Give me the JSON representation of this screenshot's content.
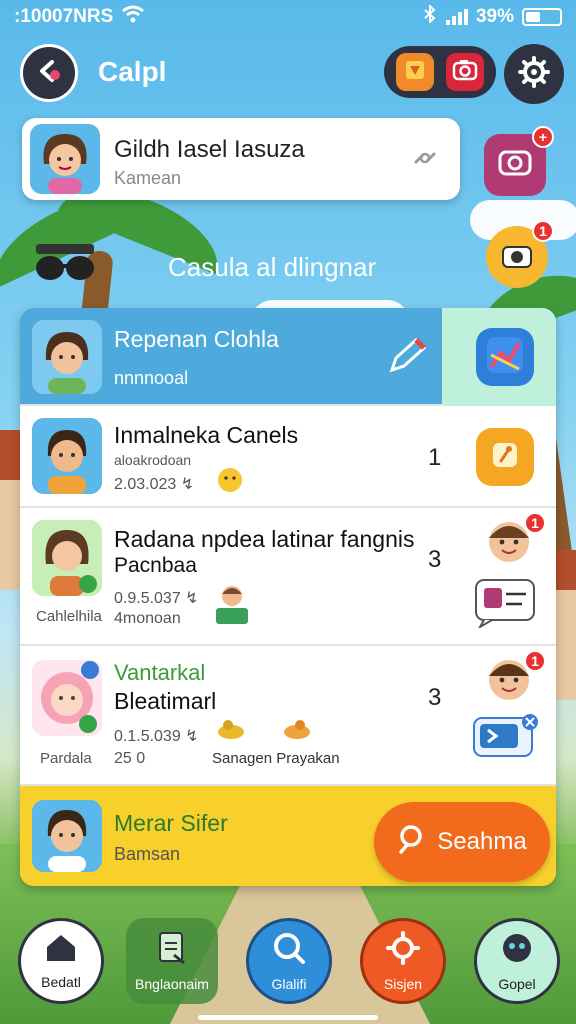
{
  "status_bar": {
    "time": ":10007NRS",
    "battery": "39%"
  },
  "header": {
    "title": "Calpl",
    "back_icon": "back-arrow-icon",
    "actions": [
      "gallery-icon",
      "camera-icon",
      "gear-icon"
    ]
  },
  "profile": {
    "name": "Gildh Iasel Iasuza",
    "subtitle": "Kamean",
    "action_icon": "link-icon"
  },
  "side_actions": [
    {
      "icon": "camera-chat-icon",
      "badge": "+"
    },
    {
      "icon": "camera-icon",
      "badge": "1"
    }
  ],
  "section": {
    "title": "Casula al dlingnar",
    "icon": "sunglasses-icon"
  },
  "list": {
    "rows": [
      {
        "title": "Repenan Clohla",
        "subtitle": "nnnnooal",
        "icon": "edit-icon",
        "side_icon": "maps-icon",
        "highlighted": true
      },
      {
        "title": "Inmalneka Canels",
        "subtitle": "aloakrodoan",
        "date": "2.03.023 ↯",
        "count": "1",
        "side_icon": "tag-icon"
      },
      {
        "title": "Radana npdea latinar fangnis",
        "subtitle": "Pacnbaa",
        "date": "0.9.5.037 ↯",
        "extra": "4monoan",
        "avatar_label": "Cahlelhila",
        "count": "3",
        "side_badge": "1"
      },
      {
        "title": "Bleatimarl",
        "title_top": "Vantarkal",
        "date": "0.1.5.039 ↯",
        "extra": "25 0",
        "avatar_label": "Pardala",
        "tag": "Sanagen Prayakan",
        "count": "3",
        "side_badge": "1"
      }
    ],
    "action_row": {
      "title": "Merar Sifer",
      "subtitle": "Bamsan",
      "button_label": "Seahma"
    }
  },
  "bottom_nav": [
    {
      "label": "Bedatl",
      "icon": "home-icon",
      "active": true
    },
    {
      "label": "Bnglaonaim",
      "icon": "document-icon",
      "active": false
    },
    {
      "label": "Glalifi",
      "icon": "search-icon",
      "active": false
    },
    {
      "label": "Sisjen",
      "icon": "gear-icon",
      "active": false
    },
    {
      "label": "Gopel",
      "icon": "face-icon",
      "active": false
    }
  ],
  "colors": {
    "accent_orange": "#f26a1b",
    "accent_yellow": "#f7d02c",
    "highlight_blue": "#4ea9dc",
    "dark": "#2f3240"
  }
}
